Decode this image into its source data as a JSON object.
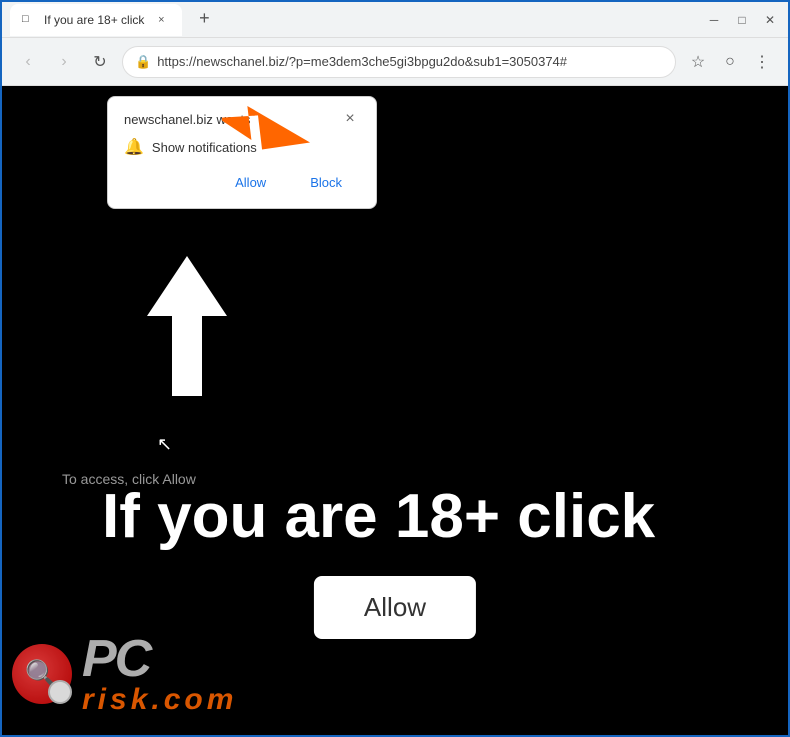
{
  "browser": {
    "title": "If you are 18+ click",
    "url": "https://newschanel.biz/?p=me3dem3che5gi3bpgu2do&sub1=3050374#",
    "tab_label": "If you are 18+ click"
  },
  "popup": {
    "title": "newschanel.biz wants",
    "notification_label": "Show notifications",
    "allow_btn": "Allow",
    "block_btn": "Block"
  },
  "page": {
    "small_text": "To access, click Allow",
    "big_text": "If you are 18+ click",
    "allow_btn": "Allow"
  },
  "watermark": {
    "pc_text": "PC",
    "risk_text": "risk.com"
  },
  "nav": {
    "back": "‹",
    "forward": "›",
    "refresh": "↻"
  },
  "icons": {
    "star": "☆",
    "account": "○",
    "menu": "⋮",
    "lock": "🔒",
    "bell": "🔔",
    "tab_icon": "□",
    "new_tab": "+",
    "close": "×"
  }
}
